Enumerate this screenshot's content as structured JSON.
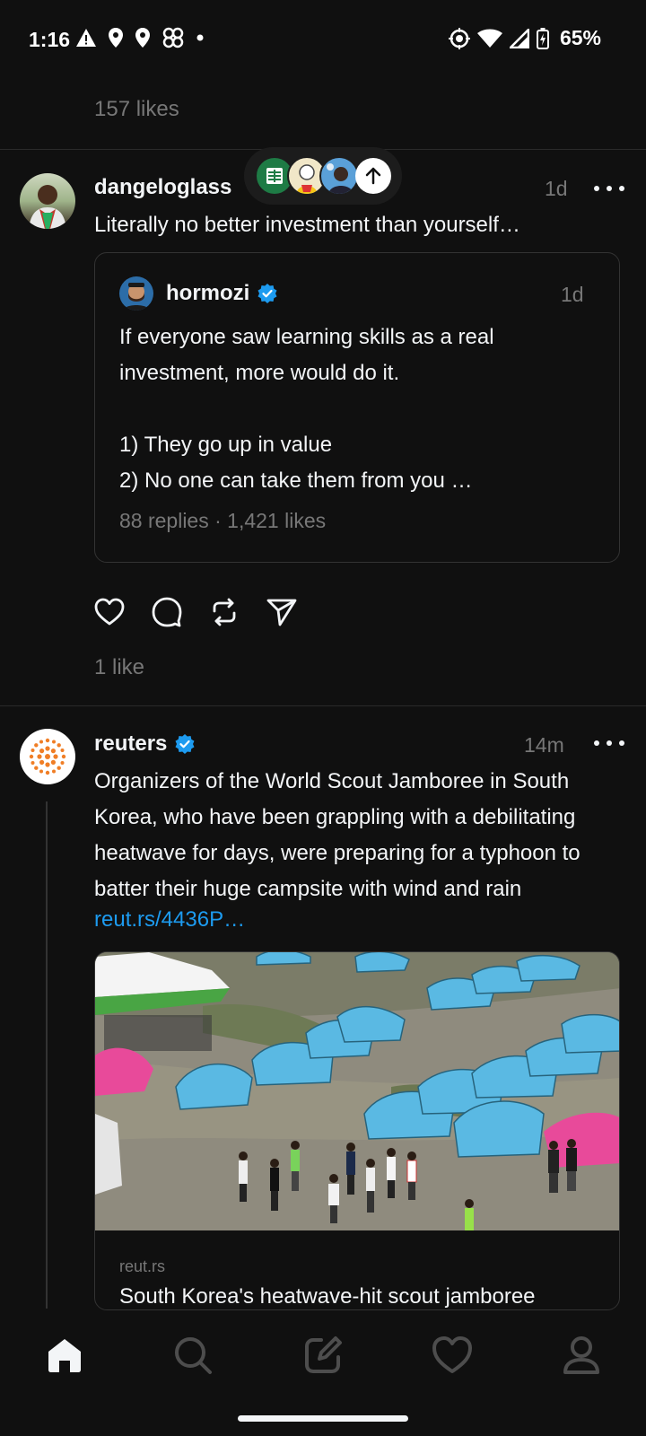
{
  "status_bar": {
    "time": "1:16",
    "battery": "65%",
    "left_icons": [
      "warning-icon",
      "location-icon",
      "location-icon",
      "pinwheel-icon",
      "dot-icon"
    ],
    "right_icons": [
      "vpn-target-icon",
      "wifi-icon",
      "signal-icon",
      "battery-charging-icon"
    ]
  },
  "prev_post": {
    "likes": "157 likes"
  },
  "new_posts_pill": {
    "avatars": [
      "sheets-avatar",
      "cartoon-avatar",
      "photo-avatar"
    ],
    "icon": "arrow-up-icon"
  },
  "post1": {
    "username": "dangeloglass",
    "time": "1d",
    "text": "Literally no better investment than yourself…",
    "quote": {
      "username": "hormozi",
      "time": "1d",
      "lines": [
        "If everyone saw learning skills as a real",
        "investment, more would do it.",
        "",
        "1) They go up in value",
        "2) No one can take them from you …"
      ],
      "stats": "88 replies · 1,421 likes"
    },
    "likes": "1 like"
  },
  "post2": {
    "username": "reuters",
    "time": "14m",
    "lines": [
      "Organizers of the World Scout Jamboree in South",
      "Korea, who have been grappling with a debilitating",
      "heatwave for days, were preparing for a typhoon to",
      "batter their huge campsite with wind and rain"
    ],
    "link": "reut.rs/4436P…",
    "card": {
      "domain": "reut.rs",
      "title": "South Korea's heatwave-hit scout jamboree"
    }
  },
  "nav": [
    "home-icon",
    "search-icon",
    "compose-icon",
    "heart-icon",
    "profile-icon"
  ],
  "colors": {
    "background": "#101010",
    "text": "#f3f5f7",
    "muted": "#777777",
    "link": "#1d9bf0",
    "verified": "#1d9bf0"
  }
}
